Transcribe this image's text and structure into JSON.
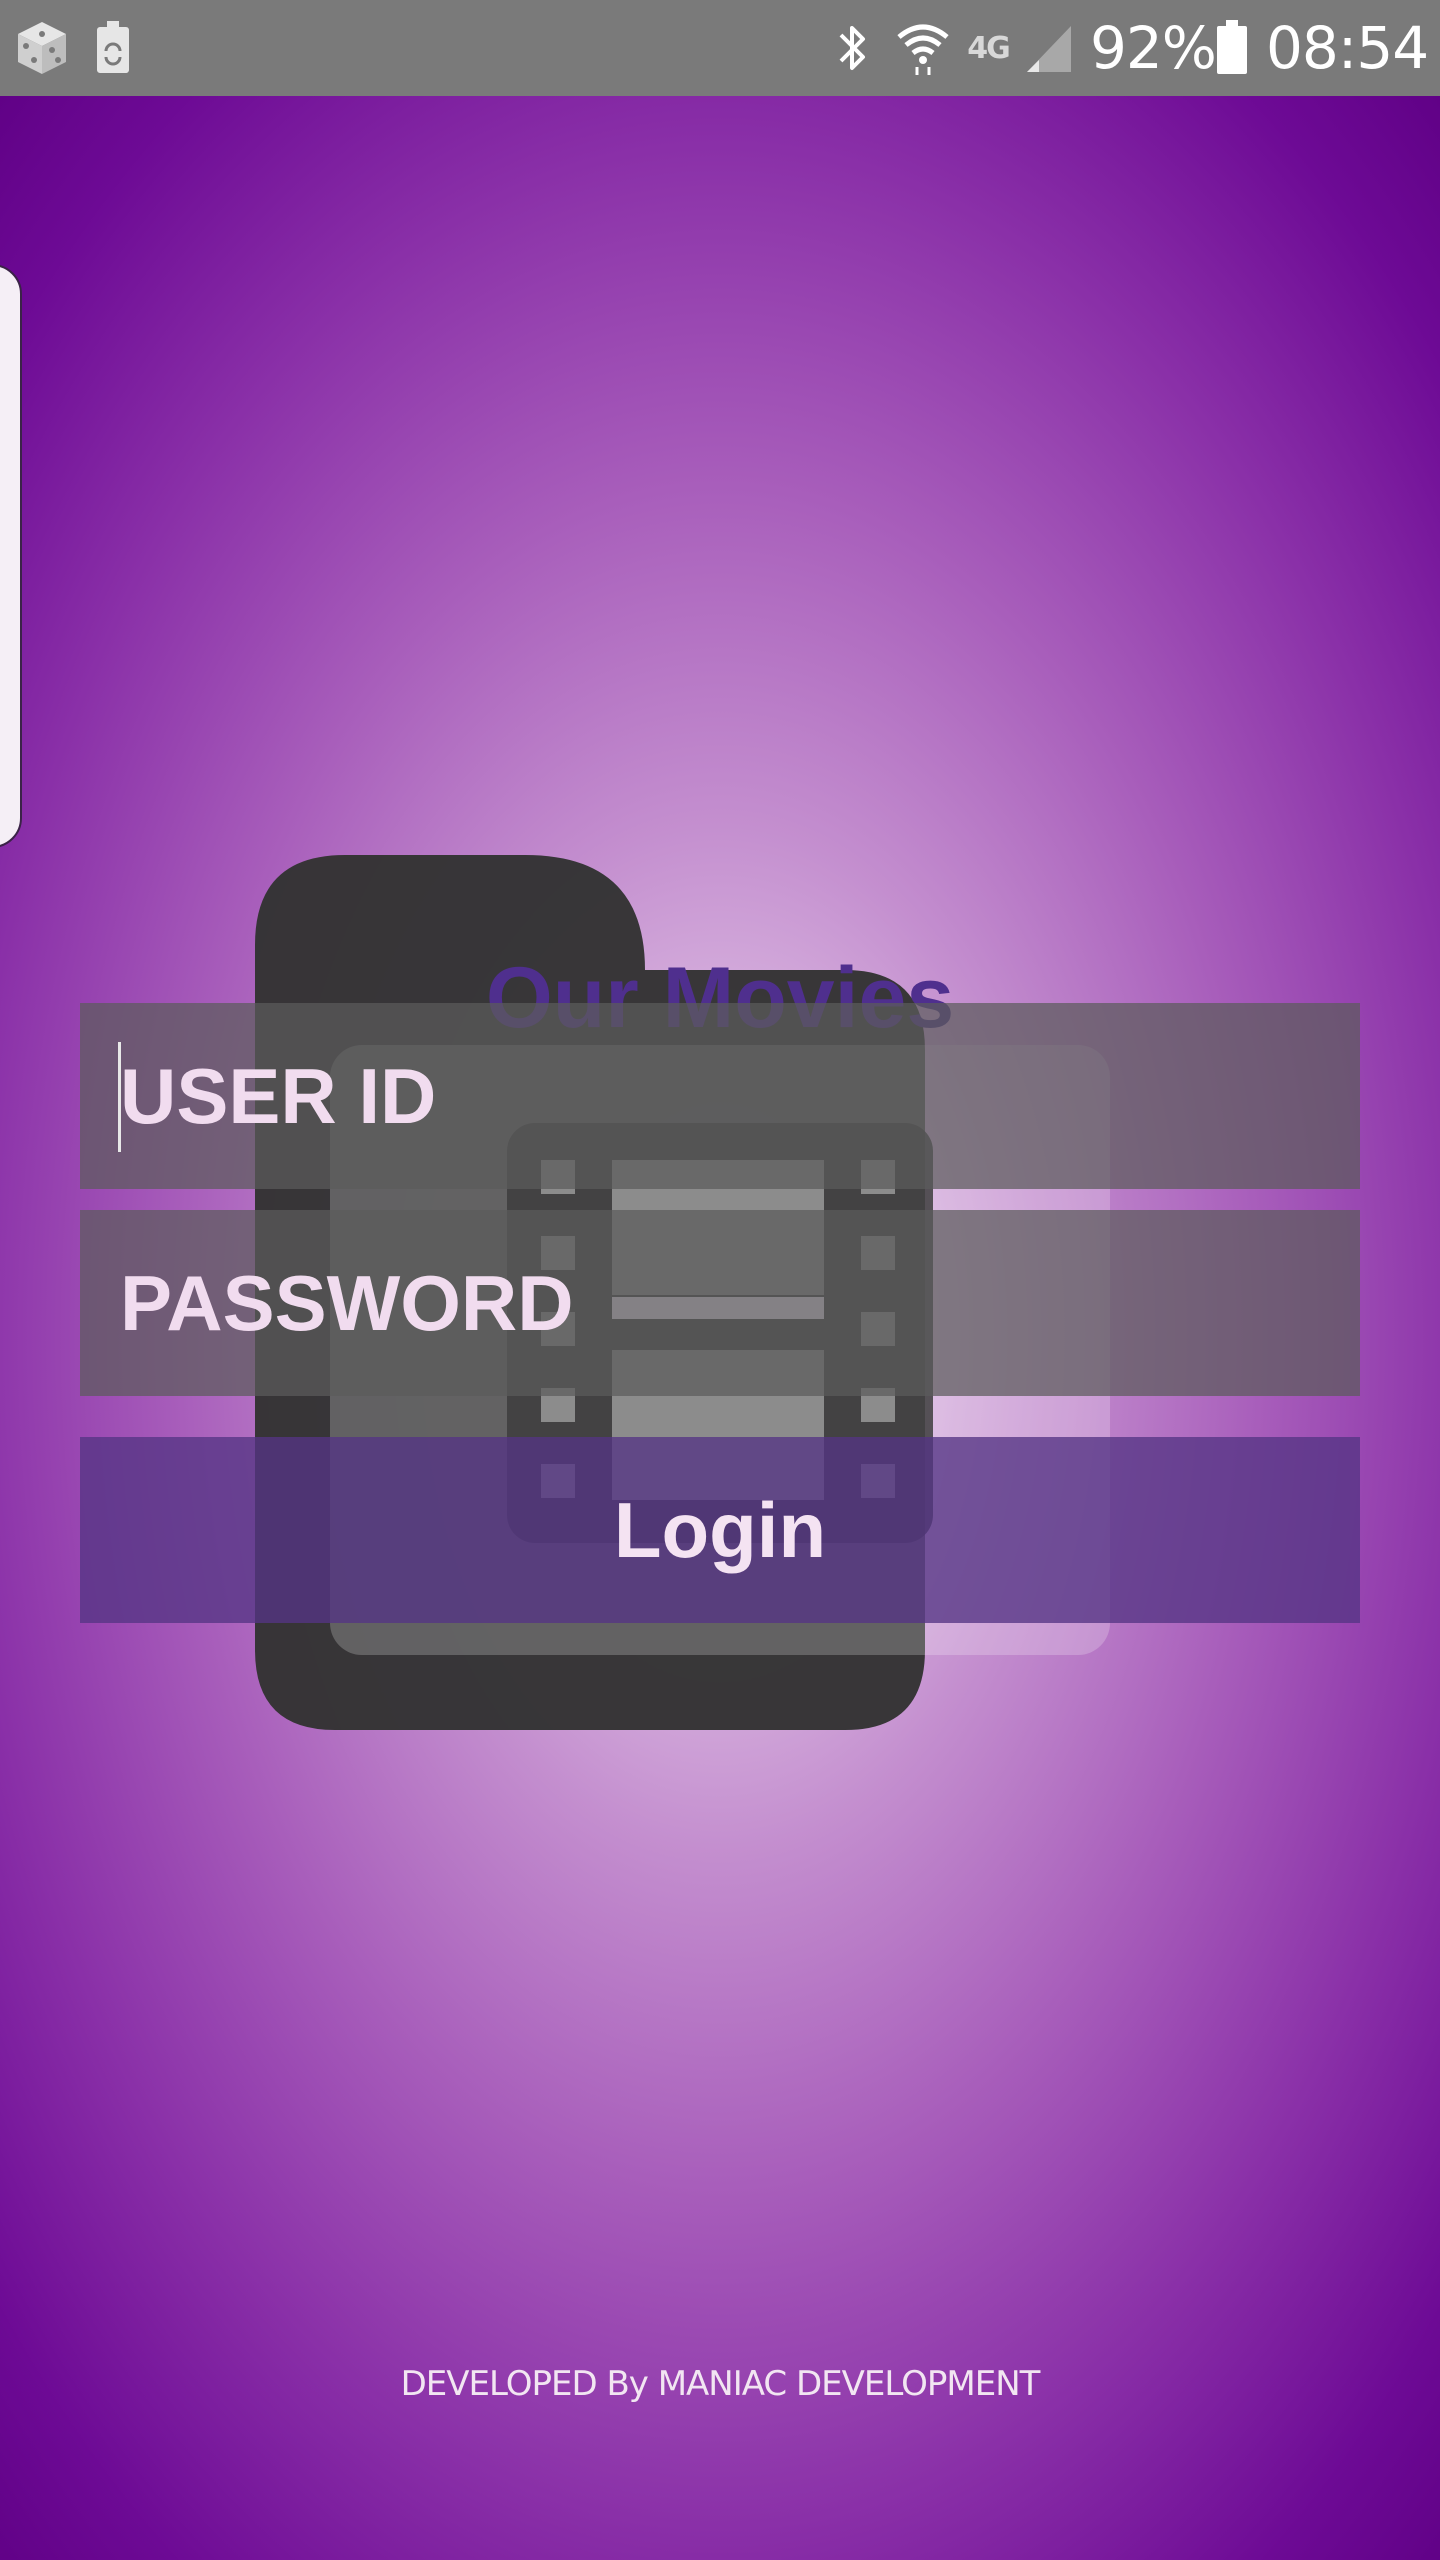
{
  "status_bar": {
    "left_icons": [
      "dice-icon",
      "battery-saver-icon"
    ],
    "right_icons": [
      "bluetooth-icon",
      "wifi-icon",
      "lte-icon",
      "signal-icon",
      "battery-icon"
    ],
    "network_label": "4G",
    "battery_percent": "92%",
    "time": "08:54"
  },
  "app": {
    "title": "Our Movies",
    "logo_icon": "folder-film-icon"
  },
  "login_form": {
    "user_id": {
      "placeholder": "USER ID",
      "value": ""
    },
    "password": {
      "placeholder": "PASSWORD",
      "value": ""
    },
    "login_label": "Login"
  },
  "footer": {
    "credit": "DEVELOPED By MANIAC DEVELOPMENT"
  },
  "colors": {
    "status_bar": "#7a7a7a",
    "background_center": "#f3e6f4",
    "background_edge": "#5f0085",
    "title": "#4f2f8e",
    "field_text": "#f1dcef",
    "button": "#543484"
  }
}
